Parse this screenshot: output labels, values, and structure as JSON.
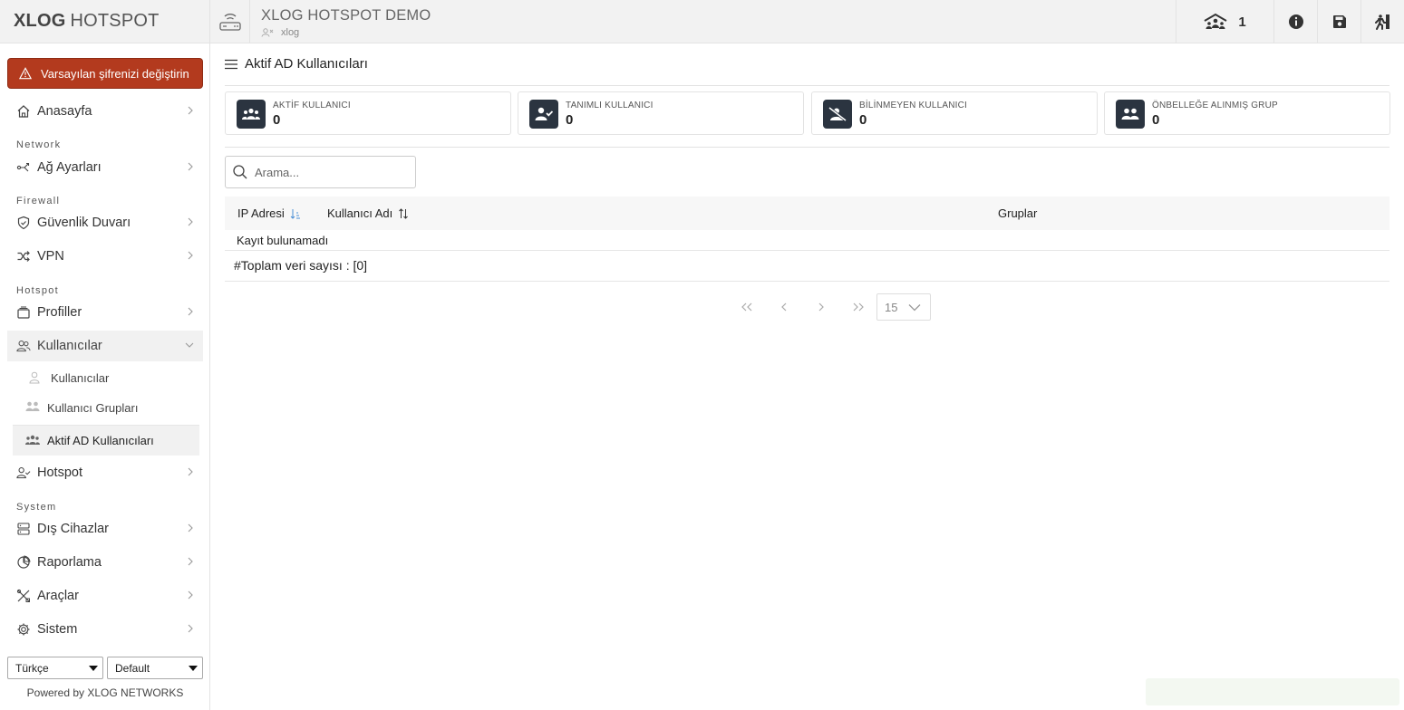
{
  "brand": {
    "bold": "XLOG",
    "rest": "HOTSPOT"
  },
  "alert": {
    "label": "Varsayılan şifrenizi değiştirin"
  },
  "sidebar": {
    "home": "Anasayfa",
    "sections": {
      "network": "Network",
      "firewall": "Firewall",
      "hotspot": "Hotspot",
      "system": "System"
    },
    "network_settings": "Ağ Ayarları",
    "firewall": "Güvenlik Duvarı",
    "vpn": "VPN",
    "profiles": "Profiller",
    "users": "Kullanıcılar",
    "sub_users": "Kullanıcılar",
    "sub_user_groups": "Kullanıcı Grupları",
    "sub_ad_users": "Aktif AD Kullanıcıları",
    "hotspot": "Hotspot",
    "external_devices": "Dış Cihazlar",
    "reporting": "Raporlama",
    "tools": "Araçlar",
    "system": "Sistem"
  },
  "footer": {
    "language": "Türkçe",
    "theme": "Default",
    "powered": "Powered by XLOG NETWORKS"
  },
  "header": {
    "title": "XLOG HOTSPOT DEMO",
    "user": "xlog",
    "online_count": "1"
  },
  "page": {
    "title": "Aktif AD Kullanıcıları",
    "stats": [
      {
        "label": "AKTİF KULLANICI",
        "value": "0"
      },
      {
        "label": "TANIMLI KULLANICI",
        "value": "0"
      },
      {
        "label": "BİLİNMEYEN KULLANICI",
        "value": "0"
      },
      {
        "label": "ÖNBELLEĞE ALINMIŞ GRUP",
        "value": "0"
      }
    ],
    "search_placeholder": "Arama...",
    "columns": {
      "ip": "IP Adresi",
      "username": "Kullanıcı Adı",
      "groups": "Gruplar"
    },
    "empty": "Kayıt bulunamadı",
    "total": "#Toplam veri sayısı : [0]",
    "page_size": "15"
  },
  "colors": {
    "alert": "#b33a1e",
    "badge": "#2b3440",
    "sort_active": "#4a8fd6"
  }
}
